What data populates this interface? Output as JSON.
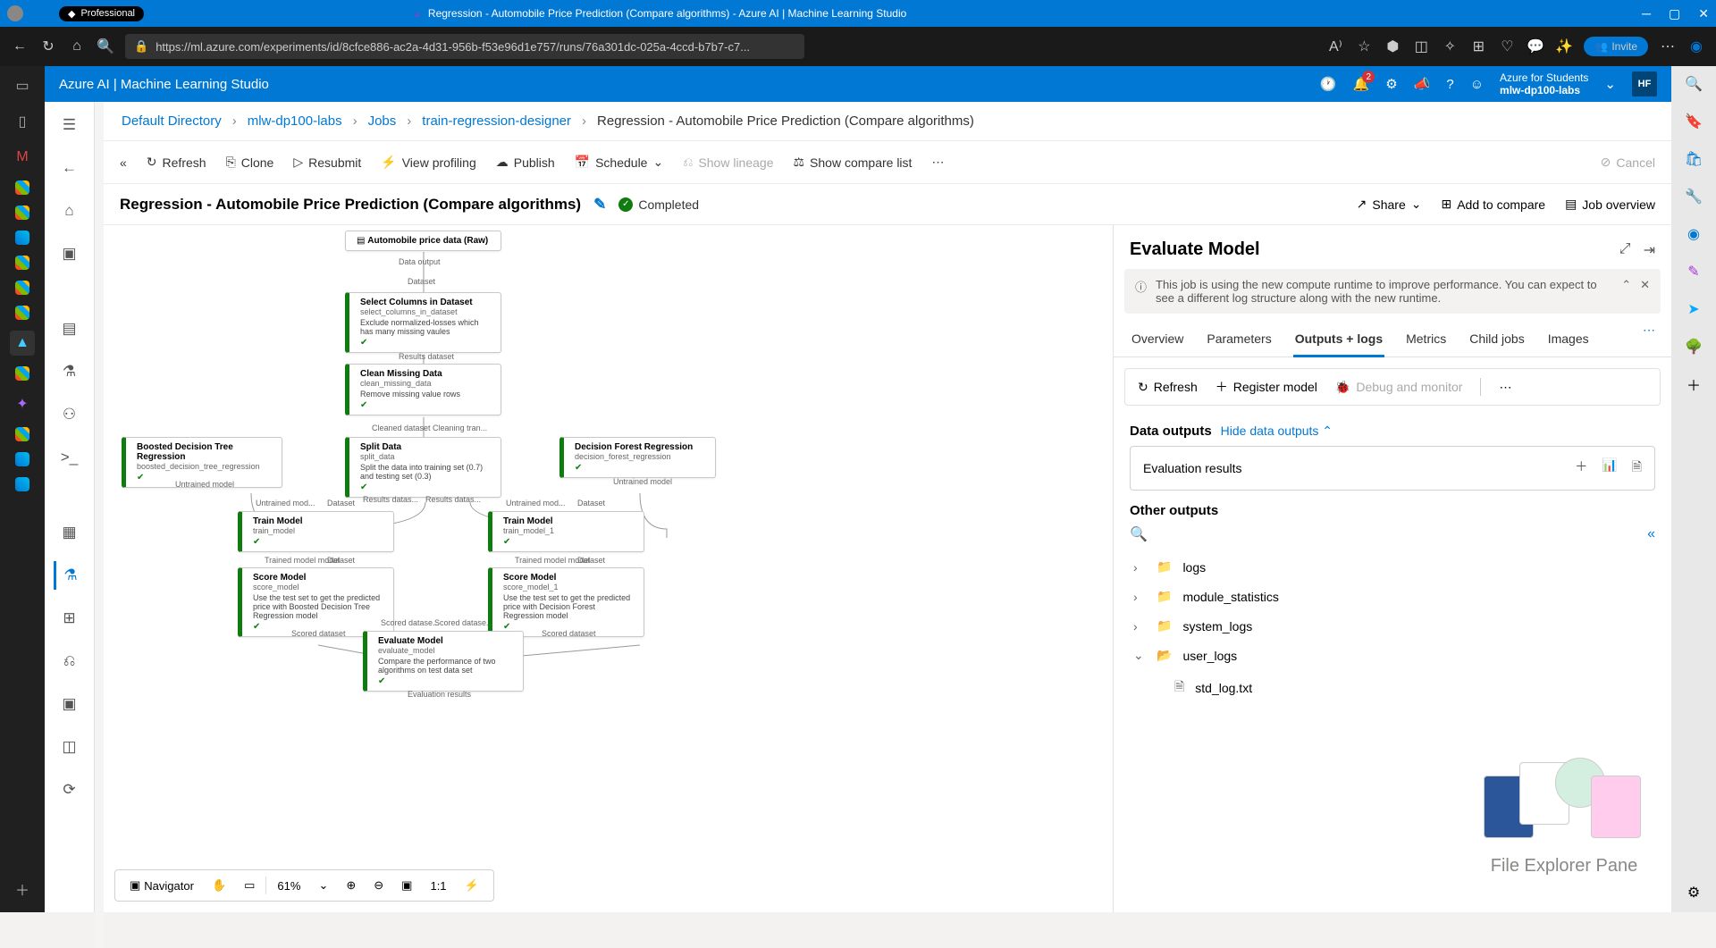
{
  "browser": {
    "profile": "Professional",
    "tab_title": "Regression - Automobile Price Prediction (Compare algorithms) - Azure AI | Machine Learning Studio",
    "url": "https://ml.azure.com/experiments/id/8cfce886-ac2a-4d31-956b-f53e96d1e757/runs/76a301dc-025a-4ccd-b7b7-c7...",
    "invite": "Invite"
  },
  "header": {
    "app_title": "Azure AI | Machine Learning Studio",
    "notif_count": "2",
    "account": {
      "plan": "Azure for Students",
      "workspace": "mlw-dp100-labs",
      "initials": "HF"
    }
  },
  "breadcrumb": {
    "items": [
      "Default Directory",
      "mlw-dp100-labs",
      "Jobs",
      "train-regression-designer"
    ],
    "current": "Regression - Automobile Price Prediction (Compare algorithms)"
  },
  "actions": {
    "refresh": "Refresh",
    "clone": "Clone",
    "resubmit": "Resubmit",
    "view_profiling": "View profiling",
    "publish": "Publish",
    "schedule": "Schedule",
    "show_lineage": "Show lineage",
    "compare_list": "Show compare list",
    "cancel": "Cancel"
  },
  "title": {
    "name": "Regression - Automobile Price Prediction (Compare algorithms)",
    "status": "Completed",
    "share": "Share",
    "add_compare": "Add to compare",
    "job_overview": "Job overview"
  },
  "canvas": {
    "zoom": "61%",
    "navigator": "Navigator",
    "nodes": {
      "n1": {
        "title": "Automobile price data (Raw)",
        "out": "Data output",
        "out2": "Dataset"
      },
      "n2": {
        "title": "Select Columns in Dataset",
        "sub": "select_columns_in_dataset",
        "desc": "Exclude normalized-losses which has many missing vaules",
        "out": "Results dataset"
      },
      "n3": {
        "title": "Clean Missing Data",
        "sub": "clean_missing_data",
        "desc": "Remove missing value rows",
        "out": "Cleaned dataset  Cleaning tran..."
      },
      "n4": {
        "title": "Split Data",
        "sub": "split_data",
        "desc": "Split the data into training set (0.7) and testing set (0.3)",
        "out1": "Results datas...",
        "out2": "Results datas..."
      },
      "n5": {
        "title": "Boosted Decision Tree Regression",
        "sub": "boosted_decision_tree_regression",
        "out": "Untrained model"
      },
      "n6": {
        "title": "Decision Forest Regression",
        "sub": "decision_forest_regression",
        "out": "Untrained model"
      },
      "n7": {
        "title": "Train Model",
        "sub": "train_model",
        "in1": "Untrained mod...",
        "in2": "Dataset",
        "out": "Trained model  model"
      },
      "n8": {
        "title": "Train Model",
        "sub": "train_model_1",
        "in1": "Untrained mod...",
        "in2": "Dataset",
        "out": "Trained model  model"
      },
      "n9": {
        "title": "Score Model",
        "sub": "score_model",
        "desc": "Use the test set to get the predicted price with Boosted Decision Tree Regression model",
        "out": "Scored dataset",
        "in2": "Dataset"
      },
      "n10": {
        "title": "Score Model",
        "sub": "score_model_1",
        "desc": "Use the test set to get the predicted price with Decision Forest Regression model",
        "out": "Scored dataset",
        "in2": "Dataset"
      },
      "n11": {
        "title": "Evaluate Model",
        "sub": "evaluate_model",
        "desc": "Compare the performance of two algorithms on test data set",
        "in1": "Scored datase...",
        "in2": "Scored datase...",
        "out": "Evaluation results"
      }
    }
  },
  "panel": {
    "title": "Evaluate Model",
    "notice": "This job is using the new compute runtime to improve performance. You can expect to see a different log structure along with the new runtime.",
    "tabs": {
      "overview": "Overview",
      "parameters": "Parameters",
      "outputs": "Outputs + logs",
      "metrics": "Metrics",
      "child": "Child jobs",
      "images": "Images"
    },
    "toolbar": {
      "refresh": "Refresh",
      "register": "Register model",
      "debug": "Debug and monitor"
    },
    "data_outputs_label": "Data outputs",
    "hide_link": "Hide data outputs",
    "eval_card": "Evaluation results",
    "other_label": "Other outputs",
    "tree": {
      "logs": "logs",
      "module_stats": "module_statistics",
      "system_logs": "system_logs",
      "user_logs": "user_logs",
      "std_log": "std_log.txt"
    },
    "promo": "File Explorer Pane"
  }
}
